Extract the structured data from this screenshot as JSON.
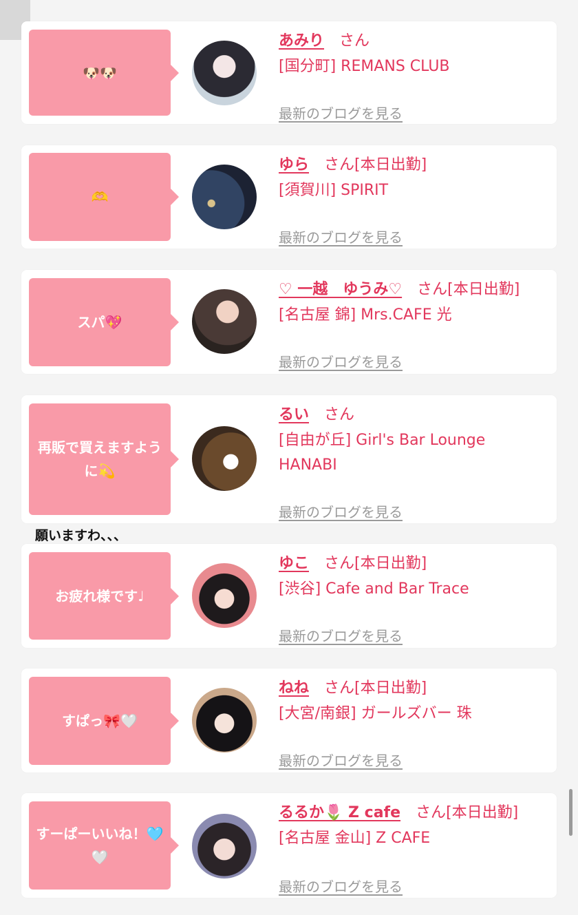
{
  "ui": {
    "accent_color": "#e2375c",
    "bubble_color": "#f99aa8",
    "link_color": "#9a9a9a"
  },
  "note": "願いますわ、、、",
  "cards": [
    {
      "comment": "🐶🐶",
      "name": "あみり",
      "san": "さん",
      "status": "",
      "shop": "[国分町] REMANS CLUB",
      "blog_link": "最新のブログを見る",
      "avatar_icon": "photo-avatar-icon"
    },
    {
      "comment": "🫶",
      "name": "ゆら",
      "san": "さん",
      "status": "[本日出勤]",
      "shop": "[須賀川] SPIRIT",
      "blog_link": "最新のブログを見る",
      "avatar_icon": "photo-avatar-icon"
    },
    {
      "comment": "スパ💖",
      "name": "♡ 一越　ゆうみ♡",
      "san": "さん",
      "status": "[本日出勤]",
      "shop": "[名古屋 錦] Mrs.CAFE 光",
      "blog_link": "最新のブログを見る",
      "avatar_icon": "photo-avatar-icon"
    },
    {
      "comment": "再販で買えますように💫",
      "name": "るい",
      "san": "さん",
      "status": "",
      "shop": "[自由が丘] Girl's Bar Lounge HANABI",
      "blog_link": "最新のブログを見る",
      "avatar_icon": "photo-avatar-icon"
    },
    {
      "comment": "お疲れ様です♩",
      "name": "ゆこ",
      "san": "さん",
      "status": "[本日出勤]",
      "shop": "[渋谷] Cafe and Bar Trace",
      "blog_link": "最新のブログを見る",
      "avatar_icon": "photo-avatar-icon"
    },
    {
      "comment": "すぱっ🎀🤍",
      "name": "ねね",
      "san": "さん",
      "status": "[本日出勤]",
      "shop": "[大宮/南銀] ガールズバー 珠",
      "blog_link": "最新のブログを見る",
      "avatar_icon": "photo-avatar-icon"
    },
    {
      "comment": "すーぱーいいね！🩵🤍",
      "name": "るるか🌷 Z cafe",
      "san": "さん",
      "status": "[本日出勤]",
      "shop": "[名古屋 金山] Z CAFE",
      "blog_link": "最新のブログを見る",
      "avatar_icon": "photo-avatar-icon"
    }
  ]
}
